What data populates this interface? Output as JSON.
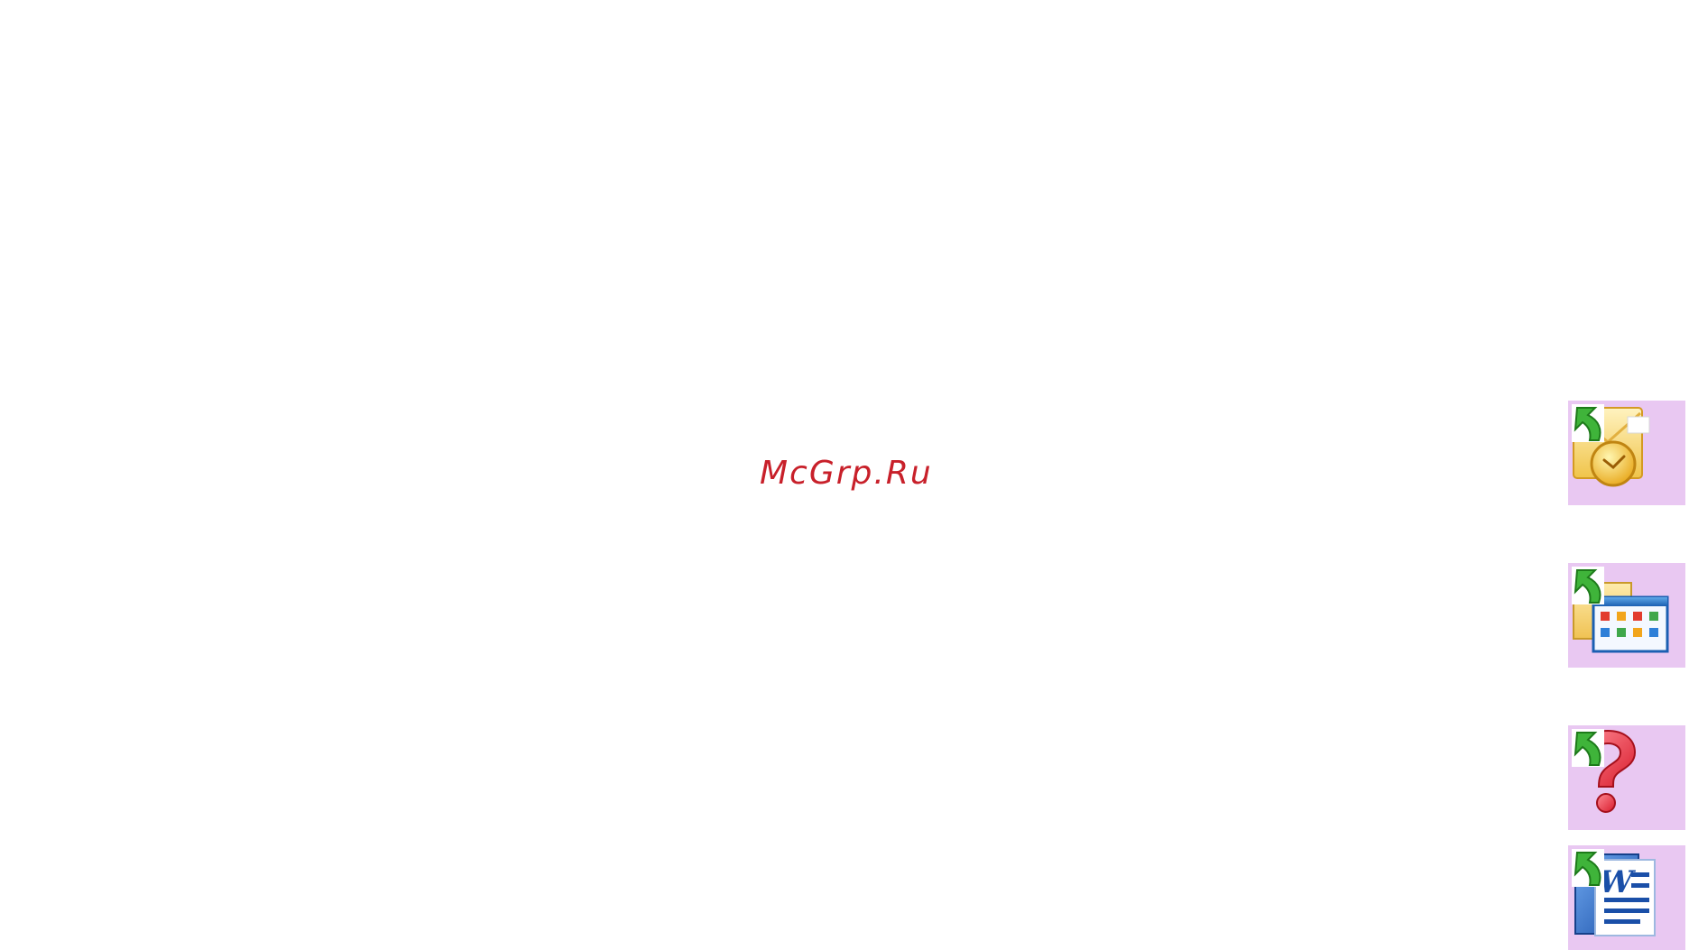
{
  "watermark": {
    "text": "McGrp.Ru",
    "color": "#c8202a"
  },
  "shortcuts": [
    {
      "icon": "outlook-icon"
    },
    {
      "icon": "folder-program-icon"
    },
    {
      "icon": "help-icon"
    },
    {
      "icon": "word-document-icon"
    }
  ],
  "colors": {
    "shortcut_background": "#e9c8f2",
    "shortcut_arrow": "#3fb43a"
  }
}
